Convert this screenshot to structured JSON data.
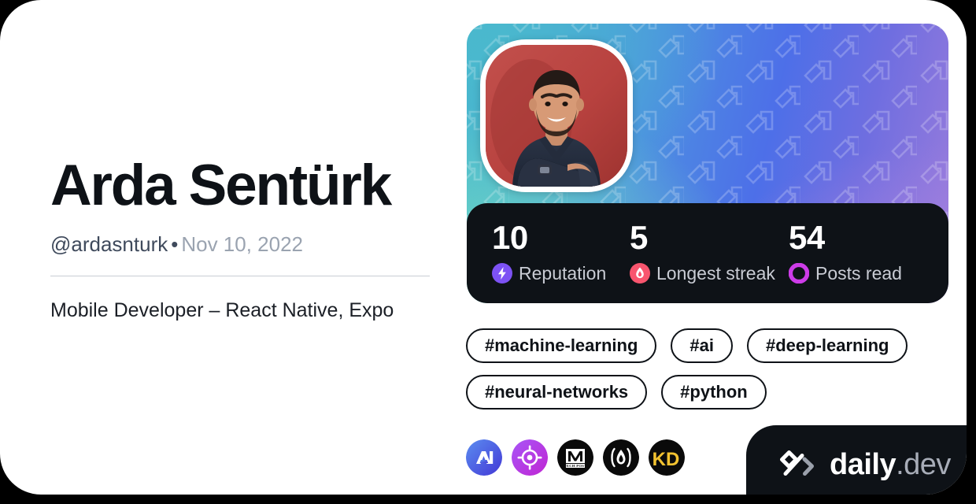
{
  "profile": {
    "name": "Arda Sentürk",
    "handle": "@ardasnturk",
    "separator": "•",
    "date": "Nov 10, 2022",
    "bio": "Mobile Developer – React Native, Expo",
    "avatar_alt": "profile-photo"
  },
  "stats": [
    {
      "value": "10",
      "label": "Reputation",
      "icon": "reputation-bolt-icon",
      "color": "#7d52f4"
    },
    {
      "value": "5",
      "label": "Longest streak",
      "icon": "streak-flame-icon",
      "color": "#f8556e"
    },
    {
      "value": "54",
      "label": "Posts read",
      "icon": "posts-read-ring-icon",
      "color": "#cd3ce8"
    }
  ],
  "tags": [
    "#machine-learning",
    "#ai",
    "#deep-learning",
    "#neural-networks",
    "#python"
  ],
  "sources": [
    {
      "name": "source-ai-icon",
      "label": "AI"
    },
    {
      "name": "source-target-icon",
      "label": ""
    },
    {
      "name": "source-marktechpost-icon",
      "label": "M",
      "sublabel": "TECH POST"
    },
    {
      "name": "source-flame-icon",
      "label": ""
    },
    {
      "name": "source-kdnuggets-icon",
      "label": "KD"
    }
  ],
  "brand": {
    "name": "daily",
    "suffix": ".dev",
    "mark": "code-brackets-icon"
  },
  "colors": {
    "card_bg": "#ffffff",
    "page_bg": "#000000",
    "text_primary": "#0e1217",
    "text_muted": "#9aa3b0",
    "handle": "#3f4a5c",
    "stats_bg": "#0e1217",
    "reputation": "#7d52f4",
    "streak": "#f8556e",
    "posts_read": "#cd3ce8"
  }
}
